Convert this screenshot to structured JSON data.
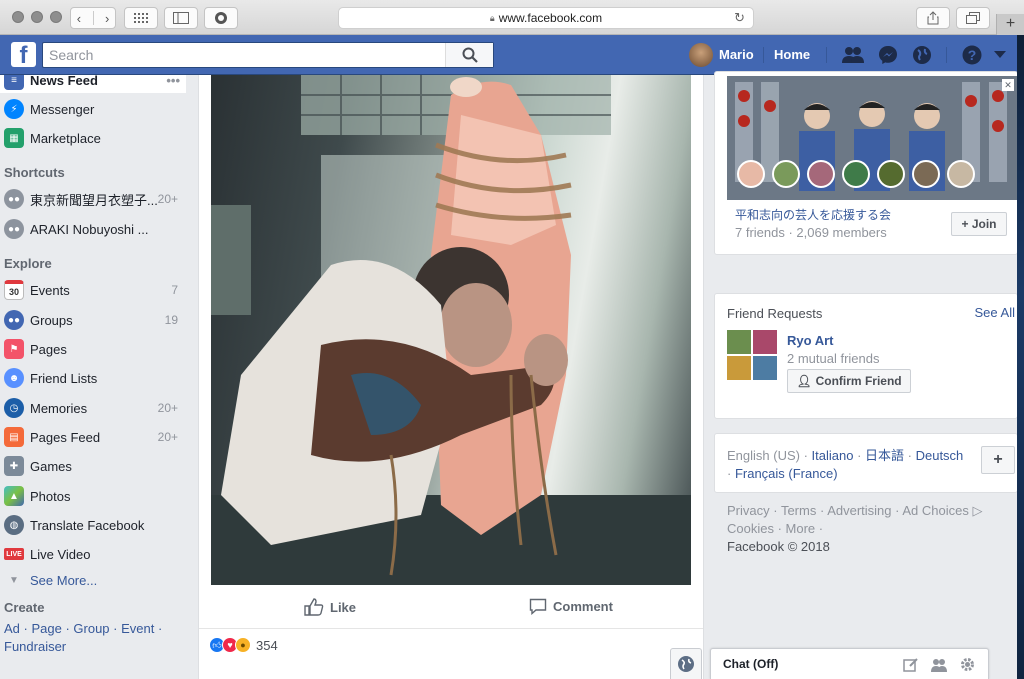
{
  "browser": {
    "url": "www.facebook.com",
    "tab_plus": "+"
  },
  "topbar": {
    "logo": "f",
    "search_placeholder": "Search",
    "user_name": "Mario",
    "home_label": "Home"
  },
  "sidebar": {
    "top_items": [
      {
        "label": "News Feed",
        "icon": "news-feed-icon"
      },
      {
        "label": "Messenger",
        "icon": "messenger-icon"
      },
      {
        "label": "Marketplace",
        "icon": "marketplace-icon"
      }
    ],
    "shortcuts_title": "Shortcuts",
    "shortcuts": [
      {
        "label": "東京新聞望月衣塑子...",
        "count": "20+"
      },
      {
        "label": "ARAKI Nobuyoshi ...",
        "count": ""
      }
    ],
    "explore_title": "Explore",
    "explore": [
      {
        "label": "Events",
        "count": "7",
        "icon": "calendar-icon",
        "badge": "30"
      },
      {
        "label": "Groups",
        "count": "19",
        "icon": "groups-icon"
      },
      {
        "label": "Pages",
        "count": "",
        "icon": "flag-icon"
      },
      {
        "label": "Friend Lists",
        "count": "",
        "icon": "friend-lists-icon"
      },
      {
        "label": "Memories",
        "count": "20+",
        "icon": "memories-icon"
      },
      {
        "label": "Pages Feed",
        "count": "20+",
        "icon": "pages-feed-icon"
      },
      {
        "label": "Games",
        "count": "",
        "icon": "gamepad-icon"
      },
      {
        "label": "Photos",
        "count": "",
        "icon": "photos-icon"
      },
      {
        "label": "Translate Facebook",
        "count": "",
        "icon": "globe-icon"
      },
      {
        "label": "Live Video",
        "count": "",
        "icon": "live-icon",
        "badge": "LIVE"
      }
    ],
    "see_more": "See More...",
    "create_title": "Create",
    "create_links": [
      "Ad",
      "Page",
      "Group",
      "Event",
      "Fundraiser"
    ],
    "link_sep": " · "
  },
  "feed": {
    "like_label": "Like",
    "comment_label": "Comment",
    "reaction_count": "354"
  },
  "right": {
    "group": {
      "name": "平和志向の芸人を応援する会",
      "stats": "7 friends · 2,069 members",
      "join_label": "+ Join",
      "close_glyph": "✕"
    },
    "friend_requests": {
      "title": "Friend Requests",
      "see_all": "See All",
      "name": "Ryo Art",
      "mutual": "2 mutual friends",
      "confirm_label": "Confirm Friend"
    },
    "languages": {
      "current": "English (US)",
      "links": [
        "Italiano",
        "日本語",
        "Deutsch",
        "Français (France)"
      ],
      "sep": " · ",
      "add_label": "+"
    },
    "footer": {
      "line1": [
        "Privacy",
        "Terms",
        "Advertising",
        "Ad Choices"
      ],
      "line2": [
        "Cookies",
        "More"
      ],
      "copyright": "Facebook © 2018"
    }
  },
  "chat": {
    "label": "Chat (Off)"
  },
  "colors": {
    "fb_blue": "#4267b2",
    "link_blue": "#365899",
    "sidebar_bg": "#e9ebee",
    "like_blue": "#1877f2",
    "love_red": "#f0284a",
    "wow_yellow": "#f7b125"
  }
}
